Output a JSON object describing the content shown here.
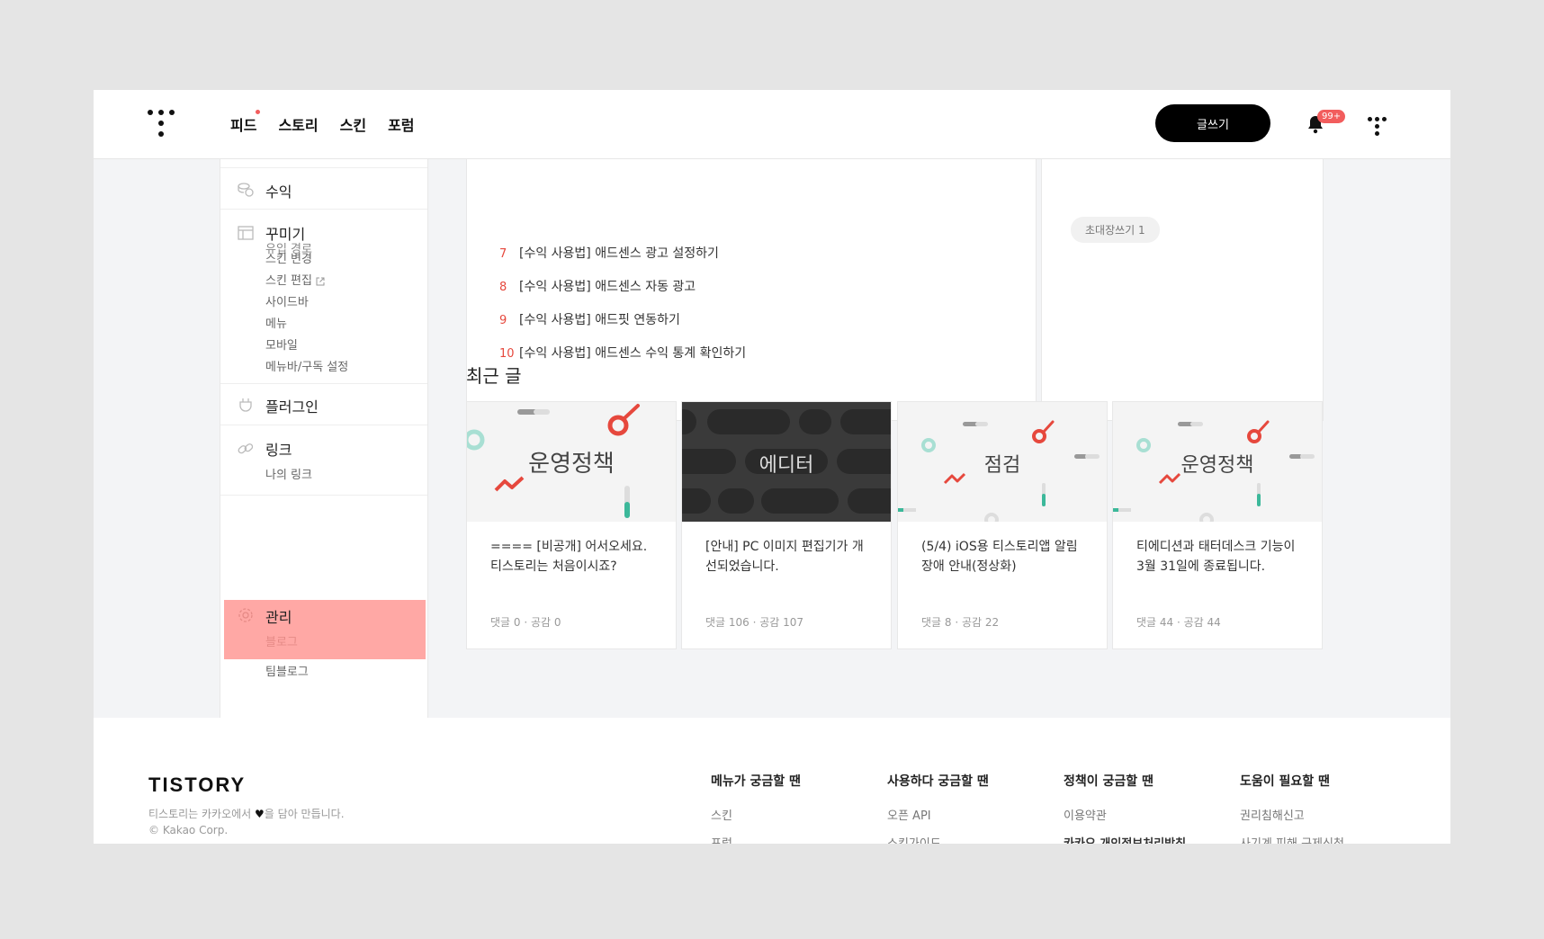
{
  "header": {
    "nav": [
      "피드",
      "스토리",
      "스킨",
      "포럼"
    ],
    "write_label": "글쓰기",
    "notification_badge": "99+"
  },
  "sidebar": {
    "cut_top_label": "유입 경로",
    "revenue": "수익",
    "decorate": {
      "title": "꾸미기",
      "items": [
        "스킨 변경",
        "스킨 편집",
        "사이드바",
        "메뉴",
        "모바일",
        "메뉴바/구독 설정"
      ]
    },
    "plugin": "플러그인",
    "link": {
      "title": "링크",
      "items": [
        "나의 링크"
      ]
    },
    "manage": {
      "title": "관리",
      "items": [
        "블로그",
        "팀블로그"
      ]
    }
  },
  "popular": [
    {
      "num": "7",
      "title": "[수익 사용법] 애드센스 광고 설정하기"
    },
    {
      "num": "8",
      "title": "[수익 사용법] 애드센스 자동 광고"
    },
    {
      "num": "9",
      "title": "[수익 사용법] 애드핏 연동하기"
    },
    {
      "num": "10",
      "title": "[수익 사용법] 애드센스 수익 통계 확인하기"
    }
  ],
  "invite_chip": "초대장쓰기  1",
  "recent": {
    "title": "최근 글",
    "cards": [
      {
        "thumb": "운영정책",
        "text": "==== [비공개] 어서오세요. 티스토리는 처음이시죠?",
        "meta": "댓글 0 · 공감 0"
      },
      {
        "thumb": "에디터",
        "text": "[안내] PC 이미지 편집기가 개선되었습니다.",
        "meta": "댓글 106 · 공감 107"
      },
      {
        "thumb": "점검",
        "text": "(5/4) iOS용 티스토리앱 알림 장애 안내(정상화)",
        "meta": "댓글 8 · 공감 22"
      },
      {
        "thumb": "운영정책",
        "text": "티에디션과 태터데스크 기능이 3월 31일에 종료됩니다.",
        "meta": "댓글 44 · 공감 44"
      }
    ]
  },
  "footer": {
    "logo": "TISTORY",
    "desc_before": "티스토리는 카카오에서 ",
    "desc_after": "을 담아 만듭니다.",
    "copyright": "© Kakao Corp.",
    "columns": [
      {
        "head": "메뉴가 궁금할 땐",
        "links": [
          "스킨",
          "포럼"
        ]
      },
      {
        "head": "사용하다 궁금할 땐",
        "links": [
          "오픈 API",
          "스킨가이드"
        ]
      },
      {
        "head": "정책이 궁금할 땐",
        "links": [
          "이용약관",
          "카카오 개인정보처리방침"
        ]
      },
      {
        "head": "도움이 필요할 땐",
        "links": [
          "권리침해신고",
          "사기계 피해 구제신청"
        ]
      }
    ]
  },
  "colors": {
    "accent_red": "#e6483d",
    "active_highlight": "#ffa8a5",
    "mint": "#3cb89a"
  }
}
